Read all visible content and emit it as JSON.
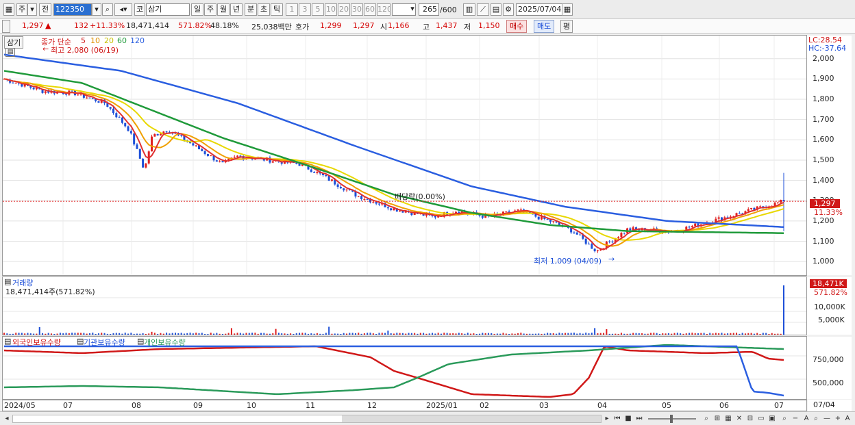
{
  "toolbar": {
    "market_label": "주",
    "period_label": "전",
    "code": "122350",
    "type_label": "코",
    "name": "삼기",
    "periods": [
      "일",
      "주",
      "월",
      "년",
      "분",
      "초",
      "틱"
    ],
    "active_period": "일",
    "intervals": [
      "1",
      "3",
      "5",
      "10",
      "20",
      "30",
      "60",
      "120"
    ],
    "count": "265",
    "count_total": "/600",
    "date": "2025/07/04"
  },
  "quote": {
    "price": "1,297",
    "arrow": "▲",
    "change": "132",
    "change_pct": "+11.33%",
    "volume": "18,471,414",
    "volume_ratio": "571.82%",
    "turnover": "48.18%",
    "amount": "25,038백만",
    "ask_label": "호가",
    "ask": "1,299",
    "bid": "1,297",
    "open_label": "시",
    "open": "1,166",
    "high_label": "고",
    "high": "1,437",
    "low_label": "저",
    "low": "1,150",
    "buy_label": "매수",
    "sell_label": "매도",
    "eval_label": "평"
  },
  "price_panel": {
    "stock_tab": "삼기",
    "legend_prefix": "종가 단순",
    "ma_periods": [
      "5",
      "10",
      "20",
      "60",
      "120"
    ],
    "ma_colors": [
      "#e03030",
      "#f0a000",
      "#e8d800",
      "#1f9a3a",
      "#2a5ee0"
    ],
    "max_note": "최고 2,080 (06/19)",
    "min_note": "최저 1,009 (04/09)",
    "dividend_note": "배당락(0.00%)",
    "lc": "LC:28.54",
    "hc": "HC:-37.64",
    "ticks": [
      "2,000",
      "1,900",
      "1,800",
      "1,700",
      "1,600",
      "1,500",
      "1,400",
      "1,300",
      "1,200",
      "1,100",
      "1,000"
    ],
    "current_price": "1,297",
    "current_pct": "11.33%"
  },
  "volume_panel": {
    "title": "거래량",
    "value_text": "18,471,414주(571.82%)",
    "badge": "18,471K",
    "badge_pct": "571.82%",
    "ticks": [
      "10,000K",
      "5,000K"
    ]
  },
  "holding_panel": {
    "series_labels": [
      "외국인보유수량",
      "기관보유수량",
      "개인보유수량"
    ],
    "series_colors": [
      "#d01818",
      "#2a5ee0",
      "#2a9a5a"
    ],
    "ticks": [
      "750,000",
      "500,000"
    ]
  },
  "x_axis": {
    "labels": [
      "2024/05",
      "07",
      "08",
      "09",
      "10",
      "11",
      "12",
      "2025/01",
      "02",
      "03",
      "04",
      "05",
      "06",
      "07"
    ],
    "right_label": "07/04"
  },
  "chart_data": {
    "type": "line",
    "ylim": [
      950,
      2080
    ],
    "close_anchor_x": [
      0,
      0.05,
      0.09,
      0.13,
      0.16,
      0.18,
      0.19,
      0.21,
      0.24,
      0.28,
      0.3,
      0.34,
      0.38,
      0.41,
      0.45,
      0.5,
      0.55,
      0.58,
      0.62,
      0.66,
      0.7,
      0.73,
      0.76,
      0.77,
      0.8,
      0.86,
      1
    ],
    "close_anchor_y": [
      1900,
      1840,
      1830,
      1780,
      1650,
      1450,
      1620,
      1650,
      1580,
      1480,
      1520,
      1500,
      1480,
      1420,
      1330,
      1260,
      1220,
      1250,
      1220,
      1250,
      1200,
      1150,
      1050,
      1080,
      1160,
      1150,
      1297
    ],
    "ma60_anchor_x": [
      0,
      0.1,
      0.18,
      0.28,
      0.4,
      0.5,
      0.6,
      0.7,
      0.8,
      1
    ],
    "ma60_anchor_y": [
      1940,
      1880,
      1760,
      1610,
      1460,
      1330,
      1240,
      1180,
      1150,
      1140
    ],
    "ma120_anchor_x": [
      0,
      0.15,
      0.3,
      0.45,
      0.6,
      0.72,
      0.85,
      1
    ],
    "ma120_anchor_y": [
      2020,
      1940,
      1780,
      1570,
      1370,
      1270,
      1200,
      1170
    ]
  }
}
